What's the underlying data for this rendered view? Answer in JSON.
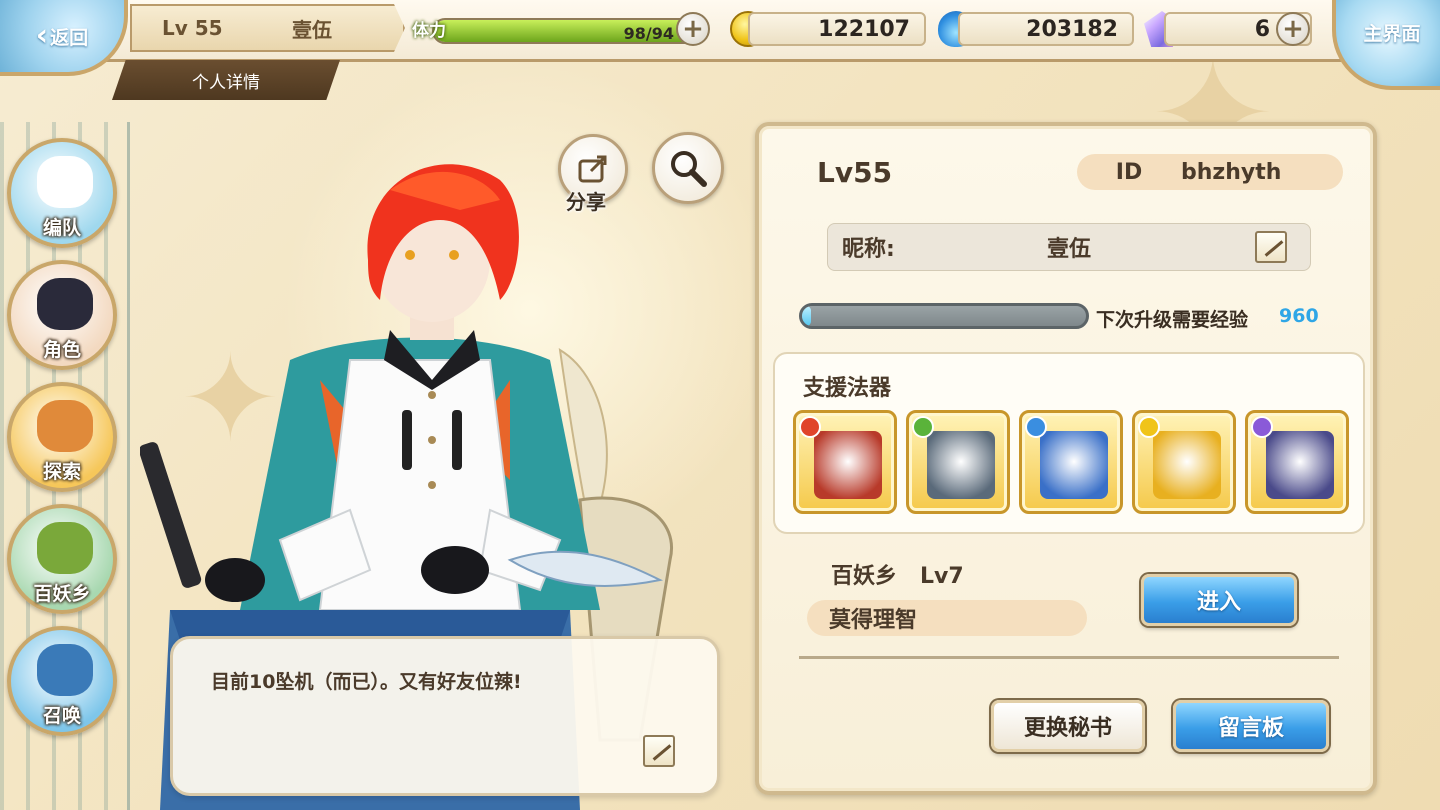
{
  "topbar": {
    "back_label": "返回",
    "level": "Lv 55",
    "player_name": "壹伍",
    "detail_tab": "个人详情",
    "stamina": {
      "label": "体力",
      "value_text": "98/94",
      "fill_fraction": 1.0
    },
    "gold": "122107",
    "spirit": "203182",
    "crystal": "6",
    "home_label": "主界面"
  },
  "leftnav": {
    "items": [
      {
        "label": "编队",
        "icon": "team-icon",
        "color": "#9fd8ee",
        "icon_color": "#ffffff"
      },
      {
        "label": "角色",
        "icon": "character-icon",
        "color": "#f3d9c0",
        "icon_color": "#2a2a3a"
      },
      {
        "label": "探索",
        "icon": "explore-icon",
        "color": "#f6c75a",
        "icon_color": "#e08a3a"
      },
      {
        "label": "百妖乡",
        "icon": "village-icon",
        "color": "#a8d8b0",
        "icon_color": "#7aa83a"
      },
      {
        "label": "召唤",
        "icon": "summon-icon",
        "color": "#7ec6ea",
        "icon_color": "#3a7ab8"
      }
    ]
  },
  "center": {
    "share_label": "分享",
    "speech": "目前10坠机（而已）。又有好友位辣!"
  },
  "panel": {
    "level": "Lv55",
    "id_key": "ID",
    "id_value": "bhzhyth",
    "nickname_key": "昵称:",
    "nickname_value": "壹伍",
    "exp_label": "下次升级需要经验",
    "exp_value": "960",
    "exp_fill_fraction": 0.02,
    "support_title": "支援法器",
    "artifacts": [
      {
        "name": "fan-artifact",
        "element_color": "#e0442a",
        "color": "#b83a2a"
      },
      {
        "name": "crossbow-artifact",
        "element_color": "#5ab33a",
        "color": "#5a6a7a"
      },
      {
        "name": "shield-artifact",
        "element_color": "#3a8ee0",
        "color": "#3a70c8"
      },
      {
        "name": "sword-gold-artifact",
        "element_color": "#f0c419",
        "color": "#e8b020"
      },
      {
        "name": "sword-dark-artifact",
        "element_color": "#8a5ad8",
        "color": "#4a4a8a"
      }
    ],
    "yokai_village": "百妖乡   Lv7",
    "yokai_village_name": "莫得理智",
    "enter_button": "进入",
    "change_secretary_button": "更换秘书",
    "message_board_button": "留言板"
  },
  "colors": {
    "panel_border": "#cfb98e",
    "blue_button": "#3a9ee8",
    "exp_value": "#2fa6e6",
    "stamina_fill": "#6da51c"
  }
}
